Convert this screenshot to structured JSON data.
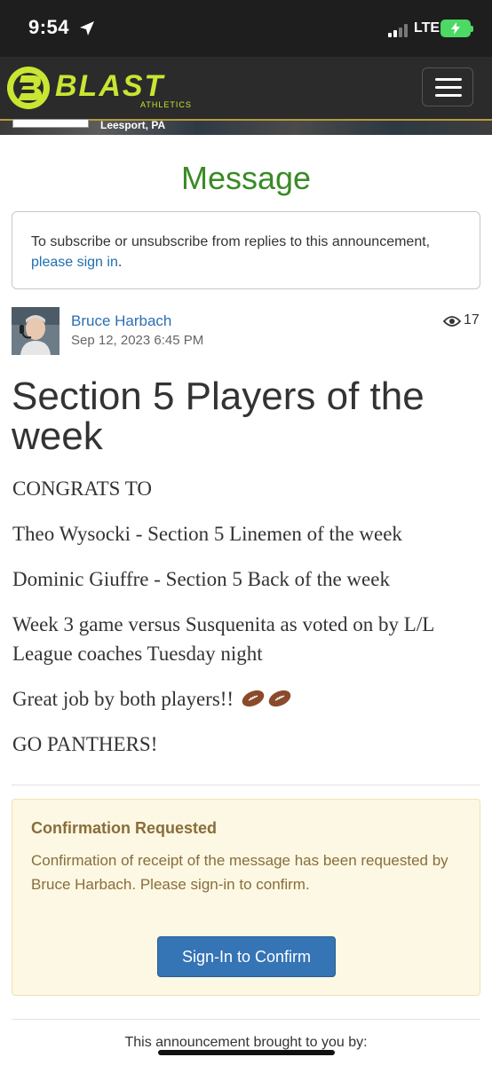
{
  "status_bar": {
    "time": "9:54",
    "network": "LTE"
  },
  "header": {
    "brand": "BLAST",
    "brand_sub": "ATHLETICS",
    "banner_location": "Leesport, PA",
    "menu_icon": "hamburger-menu-icon"
  },
  "page": {
    "title": "Message"
  },
  "subscribe": {
    "text": "To subscribe or unsubscribe from replies to this announcement, ",
    "link": "please sign in",
    "suffix": "."
  },
  "post": {
    "author": "Bruce Harbach",
    "date": "Sep 12, 2023 6:45 PM",
    "views": "17",
    "title": "Section 5 Players of the week",
    "body": [
      "CONGRATS TO",
      "Theo Wysocki - Section 5 Linemen of the week",
      "Dominic Giuffre - Section 5 Back of the week",
      "Week 3 game versus Susquenita as voted on by L/L League coaches Tuesday night",
      "Great job by both players!!",
      "GO PANTHERS!"
    ]
  },
  "confirmation": {
    "title": "Confirmation Requested",
    "text": "Confirmation of receipt of the message has been requested by Bruce Harbach. Please sign-in to confirm.",
    "button": "Sign-In to Confirm"
  },
  "footer": {
    "text": "This announcement brought to you by:"
  },
  "colors": {
    "accent_green": "#3a8a25",
    "link_blue": "#2a6fb3",
    "warning_text": "#8a6d3b",
    "warning_bg": "#fcf8e3",
    "button_blue": "#3574b5"
  }
}
